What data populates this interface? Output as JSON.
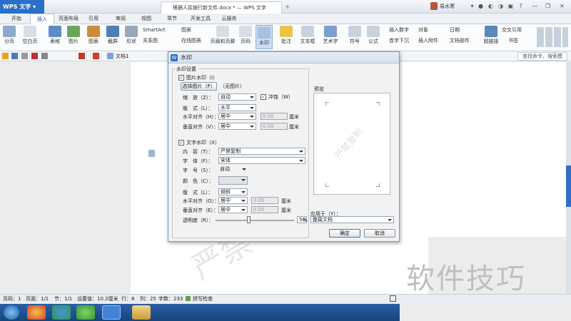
{
  "app": {
    "name": "WPS 文字",
    "doc_tab": "根据人民银行新文件.docx *",
    "window_title": "WPS 文字",
    "user": "易水寒"
  },
  "menu": [
    "开始",
    "插入",
    "页面布局",
    "引用",
    "审阅",
    "视图",
    "章节",
    "开发工具",
    "云服务"
  ],
  "menu_active": "插入",
  "ribbon": {
    "items": [
      "分页",
      "空白页",
      "表格",
      "图片",
      "图表",
      "截屏",
      "形状",
      "页眉和页脚",
      "页码",
      "水印",
      "批注",
      "文本框",
      "艺术字",
      "符号",
      "公式",
      "超链接",
      "书签"
    ],
    "small_items": [
      "SmartArt",
      "图表",
      "关系图",
      "在线图表",
      "插入数字",
      "对象",
      "日期",
      "首字下沉",
      "插入附件",
      "文档部件",
      "交叉引用"
    ]
  },
  "quickbar": {
    "doc_label": "文档1",
    "search_placeholder": "查找命令、搜索模"
  },
  "dialog": {
    "title": "水印",
    "group": "水印设置",
    "pic_check": "图片水印（I）",
    "pic_button": "选择图片（P）",
    "pic_none": "（无图片）",
    "scale_label": "缩　放（Z）：",
    "scale_value": "自动",
    "washout": "冲蚀（W）",
    "layout_label": "版　式（L）：",
    "layout_value": "水平",
    "halign_label": "水平对齐（H）：",
    "halign_value": "居中",
    "halign_num": "0.00",
    "valign_label": "垂直对齐（V）：",
    "valign_value": "居中",
    "valign_num": "0.00",
    "unit": "厘米",
    "text_check": "文字水印（X）",
    "content_label": "内　容（T）：",
    "content_value": "严禁复制",
    "font_label": "字　体（F）：",
    "font_value": "宋体",
    "size_label": "字　号（S）：",
    "size_value": "自动",
    "color_label": "颜　色（C）：",
    "tlayout_label": "版　式（L）：",
    "tlayout_value": "倾斜",
    "thalign_label": "水平对齐（O）：",
    "thalign_value": "居中",
    "thalign_num": "0.00",
    "tvalign_label": "垂直对齐（E）：",
    "tvalign_value": "居中",
    "tvalign_num": "0.00",
    "trans_label": "透明度（R）：",
    "trans_value": "50",
    "trans_unit": "%",
    "preview_label": "预览",
    "preview_text": "严禁复制",
    "apply_label": "应用于（Y）：",
    "apply_value": "整篇文档",
    "ok": "确定",
    "cancel": "取消"
  },
  "status": {
    "page": "页码：1",
    "pages": "页面：1/1",
    "section": "节：1/1",
    "setting": "设置值：10.2厘米",
    "row": "行：8",
    "col": "列：25",
    "words": "字数：233",
    "spell": "拼写检查"
  },
  "doc_watermark": "严禁",
  "corner_watermark": "软件技巧",
  "colors": {
    "accent": "#2a6fc9",
    "taskbar": "#1f4f8f"
  }
}
